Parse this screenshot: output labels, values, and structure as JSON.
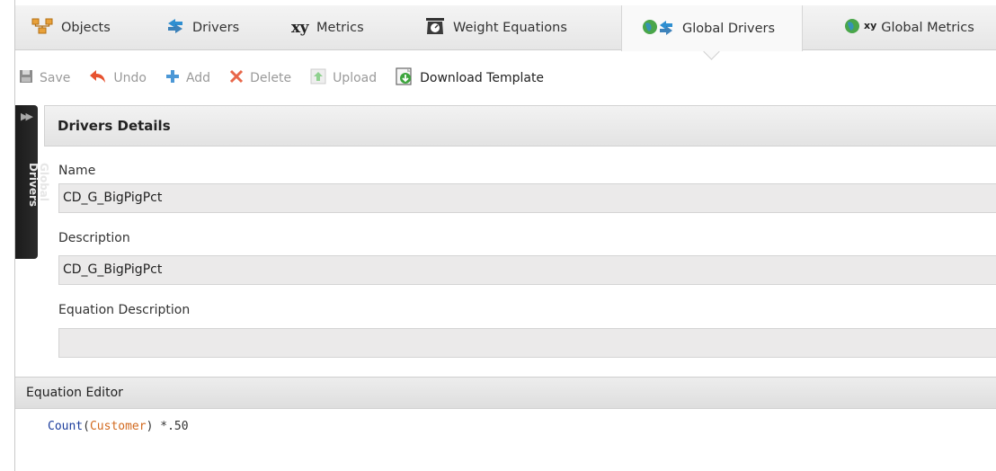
{
  "tabs": [
    {
      "label": "Objects",
      "icon": "objects-icon"
    },
    {
      "label": "Drivers",
      "icon": "drivers-icon"
    },
    {
      "label": "Metrics",
      "icon": "xy-metrics-icon",
      "prefix": "xy"
    },
    {
      "label": "Weight Equations",
      "icon": "scale-icon"
    },
    {
      "label": "Global Drivers",
      "icon": "global-drivers-icon",
      "active": true
    },
    {
      "label": "Global Metrics",
      "icon": "global-metrics-icon",
      "prefix": "xy"
    }
  ],
  "toolbar": {
    "save": "Save",
    "undo": "Undo",
    "add": "Add",
    "delete": "Delete",
    "upload": "Upload",
    "download_template": "Download Template"
  },
  "sidebar": {
    "label": "Global\nDrivers"
  },
  "details": {
    "title": "Drivers Details",
    "name_label": "Name",
    "name_value": "CD_G_BigPigPct",
    "description_label": "Description",
    "description_value": "CD_G_BigPigPct",
    "equation_description_label": "Equation Description",
    "equation_description_value": ""
  },
  "equation_editor": {
    "title": "Equation Editor",
    "fn": "Count",
    "open_paren": "(",
    "arg": "Customer",
    "close_paren": ")",
    "operator": " *.50"
  },
  "colors": {
    "accent_orange": "#e8a13a",
    "accent_blue": "#2f8fd1",
    "delete_red": "#d9534f",
    "code_function": "#1a3c9c",
    "code_argument": "#d2691e"
  }
}
